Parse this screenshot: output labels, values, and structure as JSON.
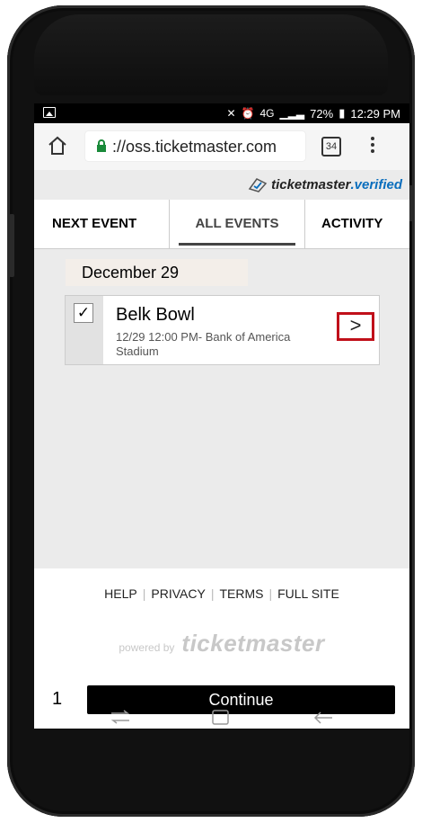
{
  "status_bar": {
    "battery": "72%",
    "time": "12:29 PM",
    "network": "4G"
  },
  "browser": {
    "url": "://oss.ticketmaster.com",
    "tab_count": "34"
  },
  "brand": {
    "verified_text": "ticketmaster",
    "verified_suffix": ".verified"
  },
  "nav": {
    "tabs": [
      {
        "label": "NEXT EVENT"
      },
      {
        "label": "ALL EVENTS"
      },
      {
        "label": "ACTIVITY"
      }
    ]
  },
  "events": {
    "date_header": "December 29",
    "items": [
      {
        "checked": "✓",
        "name": "Belk Bowl",
        "detail": "12/29 12:00 PM- Bank of America Stadium"
      }
    ]
  },
  "footer": {
    "links": [
      "HELP",
      "PRIVACY",
      "TERMS",
      "FULL SITE"
    ],
    "powered_by": "powered by",
    "brand": "ticketmaster"
  },
  "checkout": {
    "quantity": "1",
    "continue_label": "Continue"
  },
  "colors": {
    "highlight": "#c0101a",
    "verified_accent": "#0a6ebd"
  }
}
